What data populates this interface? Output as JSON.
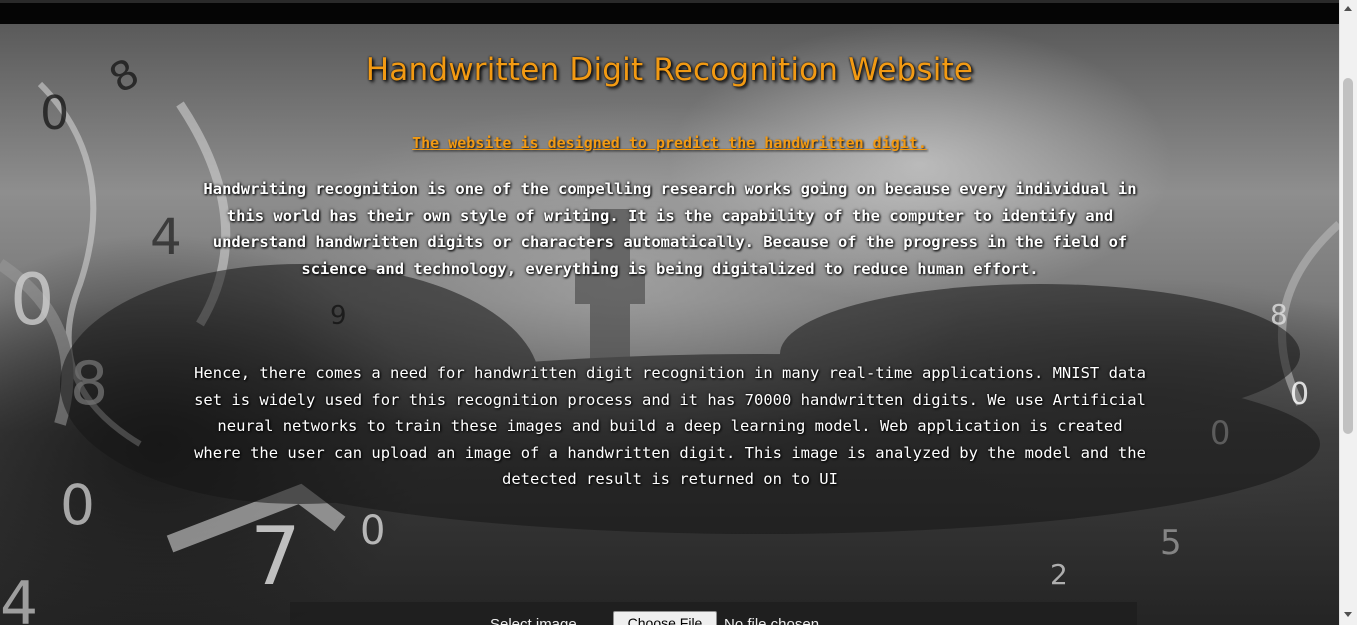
{
  "page": {
    "title": "Handwritten Digit Recognition Website",
    "subtitle": "The website is designed to predict the handwritten digit.",
    "paragraphs": [
      "Handwriting recognition is one of the compelling research works going on because every individual in this world has their own style of writing. It is the capability of the computer to identify and understand handwritten digits or characters automatically. Because of the progress in the field of science and technology, everything is being digitalized to reduce human effort.",
      "Hence, there comes a need for handwritten digit recognition in many real-time applications. MNIST data set is widely used for this recognition process and it has 70000 handwritten digits. We use Artificial neural networks to train these images and build a deep learning model. Web application is created where the user can upload an image of a handwritten digit. This image is analyzed by the model and the detected result is returned on to UI"
    ]
  },
  "upload": {
    "label": "Select image",
    "button_label": "Choose File",
    "status": "No file chosen"
  },
  "background": {
    "description_icon": "swirling-digits-background"
  },
  "colors": {
    "accent": "#f29a13",
    "text": "#ffffff",
    "upload_bar": "#1e1e1e"
  },
  "scrollbar": {
    "up_icon": "scroll-up-arrow-icon",
    "down_icon": "scroll-down-arrow-icon"
  }
}
